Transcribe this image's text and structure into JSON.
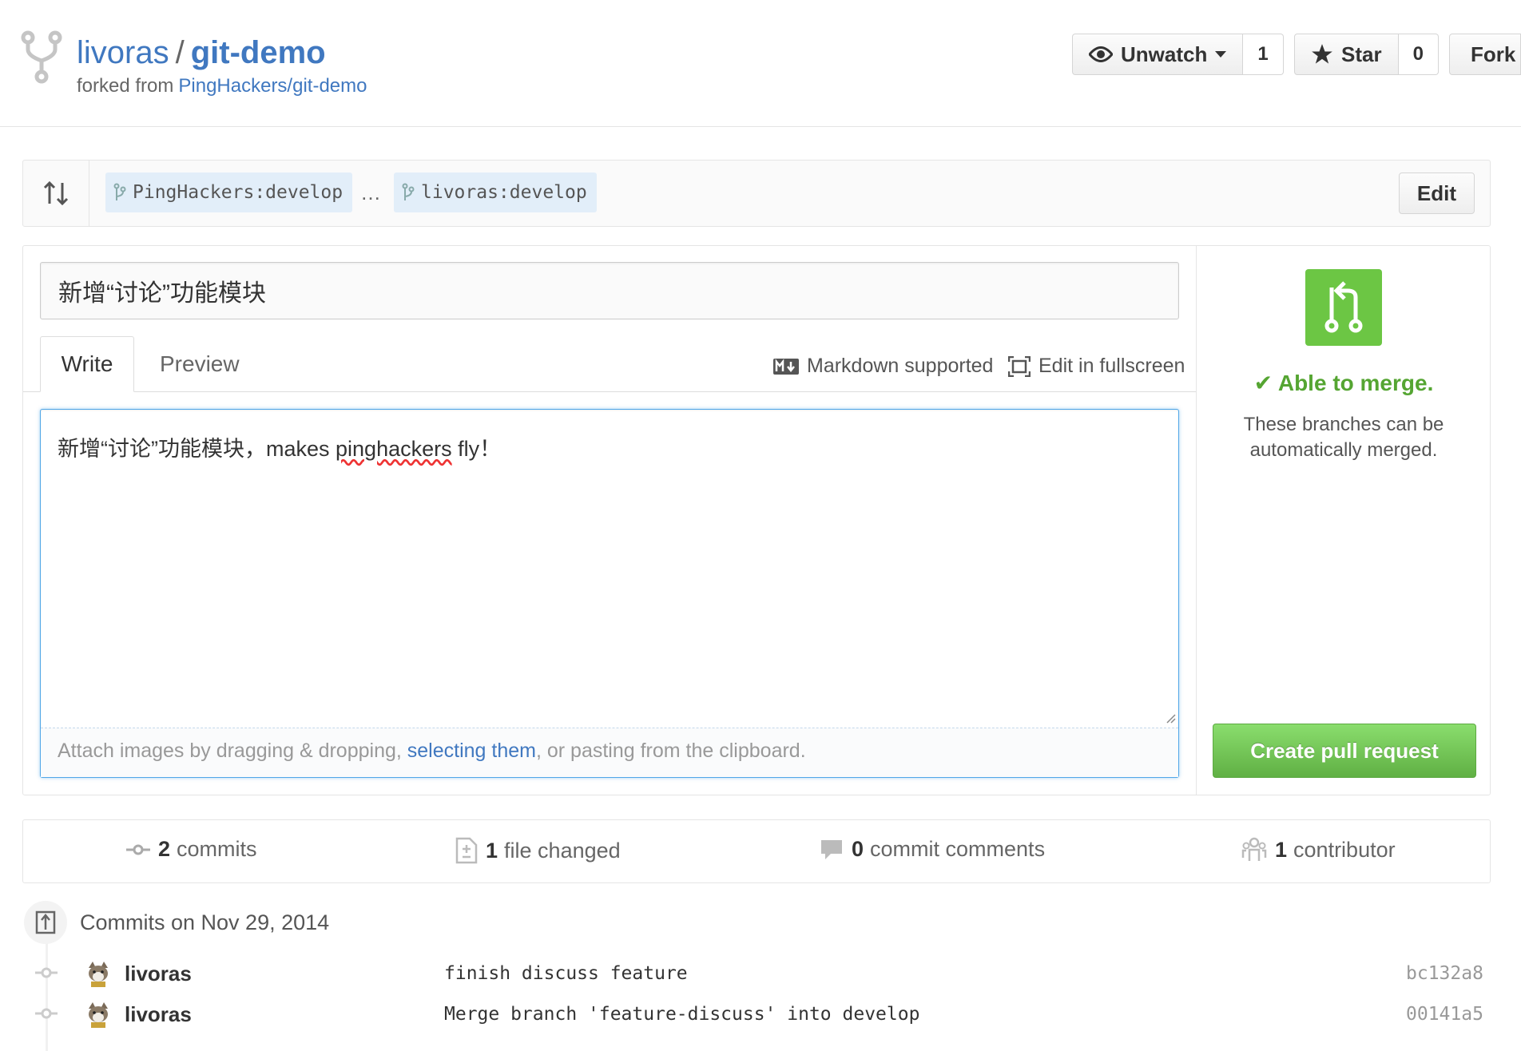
{
  "repo": {
    "owner": "livoras",
    "separator": "/",
    "name": "git-demo",
    "forked_prefix": "forked from",
    "forked_source": "PingHackers/git-demo"
  },
  "actions": {
    "unwatch_label": "Unwatch",
    "unwatch_count": "1",
    "star_label": "Star",
    "star_count": "0",
    "fork_label": "Fork"
  },
  "compare": {
    "base": "PingHackers:develop",
    "ellipsis": "…",
    "head": "livoras:develop",
    "edit_label": "Edit"
  },
  "form": {
    "title_value": "新增“讨论”功能模块",
    "tabs": [
      {
        "label": "Write"
      },
      {
        "label": "Preview"
      }
    ],
    "markdown_label": "Markdown supported",
    "fullscreen_label": "Edit in fullscreen",
    "body_prefix": "新增“讨论”功能模块，makes ",
    "body_misspelled": "pinghackers",
    "body_suffix": " fly！",
    "attach_prefix": "Attach images by dragging & dropping, ",
    "attach_link": "selecting them",
    "attach_suffix": ", or pasting from the clipboard."
  },
  "merge": {
    "status": "Able to merge.",
    "description": "These branches can be automatically merged.",
    "create_label": "Create pull request"
  },
  "summary": [
    {
      "count": "2",
      "label": "commits"
    },
    {
      "count": "1",
      "label": "file changed"
    },
    {
      "count": "0",
      "label": "commit comments"
    },
    {
      "count": "1",
      "label": "contributor"
    }
  ],
  "commits_day": "Commits on Nov 29, 2014",
  "commits": [
    {
      "author": "livoras",
      "message": "finish discuss feature",
      "sha": "bc132a8"
    },
    {
      "author": "livoras",
      "message": "Merge branch 'feature-discuss' into develop",
      "sha": "00141a5"
    }
  ],
  "colors": {
    "link": "#4078c0",
    "green": "#6cc644",
    "merge_text": "#55a532",
    "focus": "#51a7e8"
  }
}
